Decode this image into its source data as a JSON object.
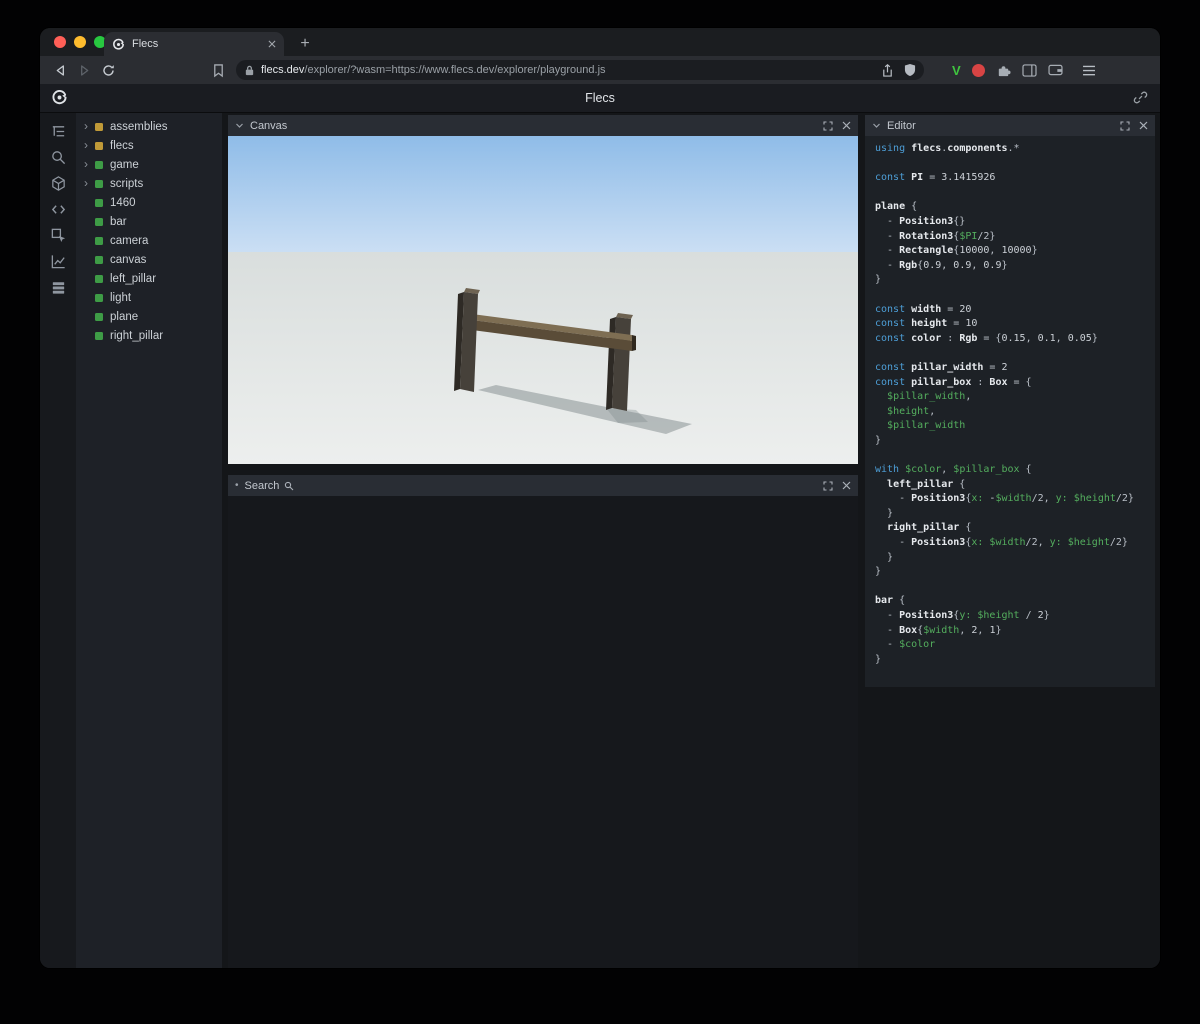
{
  "browser": {
    "tab_title": "Flecs",
    "new_tab_label": "+",
    "url": {
      "full": "flecs.dev/explorer/?wasm=https://www.flecs.dev/explorer/playground.js",
      "domain": "flecs.dev",
      "path": "/explorer/?wasm=https://www.flecs.dev/explorer/playground.js"
    }
  },
  "page": {
    "title": "Flecs"
  },
  "icon_rail": {
    "items": [
      "entity-tree-icon",
      "search-icon",
      "queries-cube-icon",
      "code-icon",
      "inspect-icon",
      "statistics-icon",
      "tables-icon"
    ]
  },
  "tree": {
    "items": [
      {
        "label": "assemblies",
        "dot_color": "#c09a38",
        "expandable": true
      },
      {
        "label": "flecs",
        "dot_color": "#c09a38",
        "expandable": true
      },
      {
        "label": "game",
        "dot_color": "#3e9c46",
        "expandable": true
      },
      {
        "label": "scripts",
        "dot_color": "#3e9c46",
        "expandable": true
      },
      {
        "label": "1460",
        "dot_color": "#3e9c46",
        "expandable": false
      },
      {
        "label": "bar",
        "dot_color": "#3e9c46",
        "expandable": false
      },
      {
        "label": "camera",
        "dot_color": "#3e9c46",
        "expandable": false
      },
      {
        "label": "canvas",
        "dot_color": "#3e9c46",
        "expandable": false
      },
      {
        "label": "left_pillar",
        "dot_color": "#3e9c46",
        "expandable": false
      },
      {
        "label": "light",
        "dot_color": "#3e9c46",
        "expandable": false
      },
      {
        "label": "plane",
        "dot_color": "#3e9c46",
        "expandable": false
      },
      {
        "label": "right_pillar",
        "dot_color": "#3e9c46",
        "expandable": false
      }
    ]
  },
  "panels": {
    "canvas": {
      "title": "Canvas"
    },
    "search": {
      "title": "Search"
    },
    "editor": {
      "title": "Editor"
    }
  },
  "canvas_scene": {
    "sky_top": "#8fbce8",
    "sky_bottom": "#cbdff4",
    "ground_top": "#d9dedd",
    "ground_bottom": "#edefee",
    "bar_top": "#7e6e53",
    "bar_front": "#5a4c38",
    "pillar_front": "#46413a",
    "pillar_side": "#2e2a25",
    "shadow": "#7f8a8c"
  },
  "colors": {
    "keyword_blue": "#4d9ed6",
    "variable_green": "#54ae5e",
    "assembly_yellow": "#c09a38",
    "module_green": "#3e9c46",
    "traffic_red": "#ff5f57",
    "traffic_yellow": "#febc2e",
    "traffic_green": "#28c840"
  },
  "editor": {
    "code_lines": [
      [
        [
          "kw",
          "using"
        ],
        [
          "txt",
          " "
        ],
        [
          "id",
          "flecs"
        ],
        [
          "pun",
          "."
        ],
        [
          "id",
          "components"
        ],
        [
          "pun",
          ".*"
        ]
      ],
      [],
      [
        [
          "kw",
          "const"
        ],
        [
          "txt",
          " "
        ],
        [
          "id",
          "PI"
        ],
        [
          "pun",
          " = "
        ],
        [
          "num",
          "3.1415926"
        ]
      ],
      [],
      [
        [
          "id",
          "plane"
        ],
        [
          "pun",
          " {"
        ]
      ],
      [
        [
          "pun",
          "  - "
        ],
        [
          "id",
          "Position3"
        ],
        [
          "pun",
          "{}"
        ]
      ],
      [
        [
          "pun",
          "  - "
        ],
        [
          "id",
          "Rotation3"
        ],
        [
          "pun",
          "{"
        ],
        [
          "var",
          "$PI"
        ],
        [
          "pun",
          "/2}"
        ]
      ],
      [
        [
          "pun",
          "  - "
        ],
        [
          "id",
          "Rectangle"
        ],
        [
          "pun",
          "{"
        ],
        [
          "num",
          "10000"
        ],
        [
          "pun",
          ", "
        ],
        [
          "num",
          "10000"
        ],
        [
          "pun",
          "}"
        ]
      ],
      [
        [
          "pun",
          "  - "
        ],
        [
          "id",
          "Rgb"
        ],
        [
          "pun",
          "{"
        ],
        [
          "num",
          "0.9"
        ],
        [
          "pun",
          ", "
        ],
        [
          "num",
          "0.9"
        ],
        [
          "pun",
          ", "
        ],
        [
          "num",
          "0.9"
        ],
        [
          "pun",
          "}"
        ]
      ],
      [
        [
          "pun",
          "}"
        ]
      ],
      [],
      [
        [
          "kw",
          "const"
        ],
        [
          "txt",
          " "
        ],
        [
          "id",
          "width"
        ],
        [
          "pun",
          " = "
        ],
        [
          "num",
          "20"
        ]
      ],
      [
        [
          "kw",
          "const"
        ],
        [
          "txt",
          " "
        ],
        [
          "id",
          "height"
        ],
        [
          "pun",
          " = "
        ],
        [
          "num",
          "10"
        ]
      ],
      [
        [
          "kw",
          "const"
        ],
        [
          "txt",
          " "
        ],
        [
          "id",
          "color"
        ],
        [
          "pun",
          " : "
        ],
        [
          "id",
          "Rgb"
        ],
        [
          "pun",
          " = {"
        ],
        [
          "num",
          "0.15"
        ],
        [
          "pun",
          ", "
        ],
        [
          "num",
          "0.1"
        ],
        [
          "pun",
          ", "
        ],
        [
          "num",
          "0.05"
        ],
        [
          "pun",
          "}"
        ]
      ],
      [],
      [
        [
          "kw",
          "const"
        ],
        [
          "txt",
          " "
        ],
        [
          "id",
          "pillar_width"
        ],
        [
          "pun",
          " = "
        ],
        [
          "num",
          "2"
        ]
      ],
      [
        [
          "kw",
          "const"
        ],
        [
          "txt",
          " "
        ],
        [
          "id",
          "pillar_box"
        ],
        [
          "pun",
          " : "
        ],
        [
          "id",
          "Box"
        ],
        [
          "pun",
          " = {"
        ]
      ],
      [
        [
          "pun",
          "  "
        ],
        [
          "var",
          "$pillar_width"
        ],
        [
          "pun",
          ","
        ]
      ],
      [
        [
          "pun",
          "  "
        ],
        [
          "var",
          "$height"
        ],
        [
          "pun",
          ","
        ]
      ],
      [
        [
          "pun",
          "  "
        ],
        [
          "var",
          "$pillar_width"
        ]
      ],
      [
        [
          "pun",
          "}"
        ]
      ],
      [],
      [
        [
          "kw",
          "with"
        ],
        [
          "txt",
          " "
        ],
        [
          "var",
          "$color"
        ],
        [
          "pun",
          ", "
        ],
        [
          "var",
          "$pillar_box"
        ],
        [
          "pun",
          " {"
        ]
      ],
      [
        [
          "pun",
          "  "
        ],
        [
          "id",
          "left_pillar"
        ],
        [
          "pun",
          " {"
        ]
      ],
      [
        [
          "pun",
          "    - "
        ],
        [
          "id",
          "Position3"
        ],
        [
          "pun",
          "{"
        ],
        [
          "key",
          "x:"
        ],
        [
          "txt",
          " -"
        ],
        [
          "var",
          "$width"
        ],
        [
          "pun",
          "/2, "
        ],
        [
          "key",
          "y:"
        ],
        [
          "txt",
          " "
        ],
        [
          "var",
          "$height"
        ],
        [
          "pun",
          "/2}"
        ]
      ],
      [
        [
          "pun",
          "  }"
        ]
      ],
      [
        [
          "pun",
          "  "
        ],
        [
          "id",
          "right_pillar"
        ],
        [
          "pun",
          " {"
        ]
      ],
      [
        [
          "pun",
          "    - "
        ],
        [
          "id",
          "Position3"
        ],
        [
          "pun",
          "{"
        ],
        [
          "key",
          "x:"
        ],
        [
          "txt",
          " "
        ],
        [
          "var",
          "$width"
        ],
        [
          "pun",
          "/2, "
        ],
        [
          "key",
          "y:"
        ],
        [
          "txt",
          " "
        ],
        [
          "var",
          "$height"
        ],
        [
          "pun",
          "/2}"
        ]
      ],
      [
        [
          "pun",
          "  }"
        ]
      ],
      [
        [
          "pun",
          "}"
        ]
      ],
      [],
      [
        [
          "id",
          "bar"
        ],
        [
          "pun",
          " {"
        ]
      ],
      [
        [
          "pun",
          "  - "
        ],
        [
          "id",
          "Position3"
        ],
        [
          "pun",
          "{"
        ],
        [
          "key",
          "y:"
        ],
        [
          "txt",
          " "
        ],
        [
          "var",
          "$height"
        ],
        [
          "pun",
          " / "
        ],
        [
          "num",
          "2"
        ],
        [
          "pun",
          "}"
        ]
      ],
      [
        [
          "pun",
          "  - "
        ],
        [
          "id",
          "Box"
        ],
        [
          "pun",
          "{"
        ],
        [
          "var",
          "$width"
        ],
        [
          "pun",
          ", "
        ],
        [
          "num",
          "2"
        ],
        [
          "pun",
          ", "
        ],
        [
          "num",
          "1"
        ],
        [
          "pun",
          "}"
        ]
      ],
      [
        [
          "pun",
          "  - "
        ],
        [
          "var",
          "$color"
        ]
      ],
      [
        [
          "pun",
          "}"
        ]
      ]
    ]
  }
}
